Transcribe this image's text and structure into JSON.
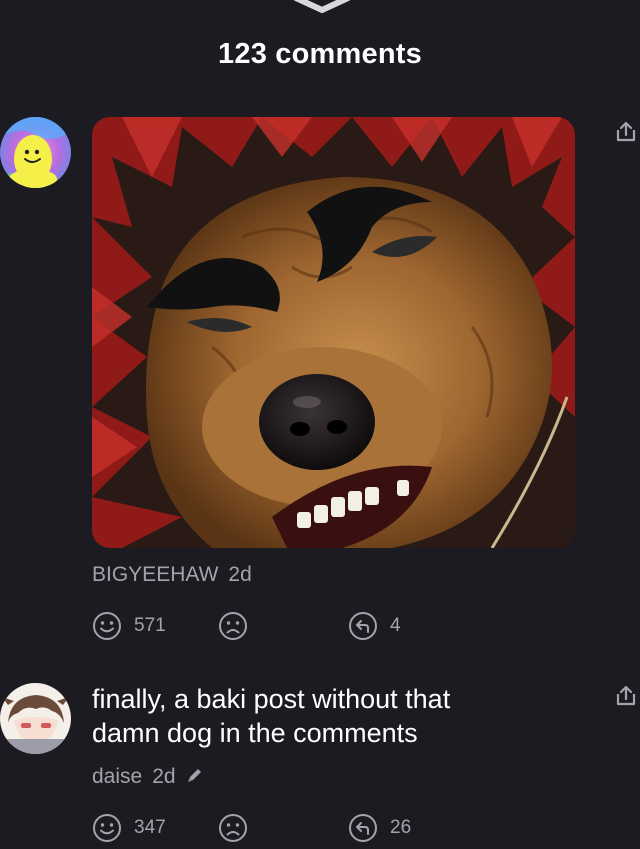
{
  "header": {
    "title": "123 comments"
  },
  "comments": [
    {
      "username": "BIGYEEHAW",
      "time": "2d",
      "likes": "571",
      "replies": "4",
      "has_image": true,
      "image_icon": "dog-meme-image"
    },
    {
      "username": "daise",
      "time": "2d",
      "text_line1": "finally, a baki post without that",
      "text_line2": "damn dog in the comments",
      "edited": true,
      "likes": "347",
      "replies": "26"
    }
  ],
  "icons": {
    "collapse": "chevron-down-icon",
    "share": "share-icon",
    "like": "smile-icon",
    "dislike": "frown-icon",
    "reply": "reply-icon",
    "edit": "pencil-icon"
  },
  "colors": {
    "background": "#1b1b21",
    "text_primary": "#ffffff",
    "text_secondary": "#a3a3ab"
  }
}
